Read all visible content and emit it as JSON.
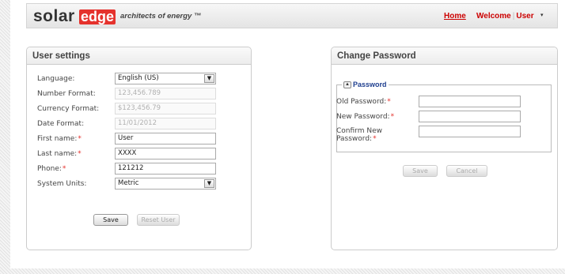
{
  "header": {
    "logo_solar": "solar",
    "logo_edge": "edge",
    "tagline": "architects of energy ™",
    "home_link": "Home",
    "welcome_label": "Welcome",
    "separator": "|",
    "user_name": "User",
    "menu_caret": "▾"
  },
  "user_settings": {
    "title": "User settings",
    "rows": {
      "language": {
        "label": "Language:",
        "value": "English (US)"
      },
      "number_format": {
        "label": "Number Format:",
        "placeholder": "123,456.789"
      },
      "currency_format": {
        "label": "Currency Format:",
        "placeholder": "$123,456.79"
      },
      "date_format": {
        "label": "Date Format:",
        "placeholder": "11/01/2012"
      },
      "first_name": {
        "label": "First name:",
        "value": "User"
      },
      "last_name": {
        "label": "Last name:",
        "value": "XXXX"
      },
      "phone": {
        "label": "Phone:",
        "value": "121212"
      },
      "system_units": {
        "label": "System Units:",
        "value": "Metric"
      }
    },
    "required_marker": "*",
    "save_label": "Save",
    "reset_label": "Reset User"
  },
  "change_password": {
    "title": "Change Password",
    "group_label": "Password",
    "collapse_glyph": "▲",
    "old_password_label": "Old Password:",
    "new_password_label": "New Password:",
    "confirm_password_label": "Confirm New Password:",
    "required_marker": "*",
    "save_label": "Save",
    "cancel_label": "Cancel"
  },
  "colors": {
    "brand_red": "#e5322d",
    "link_red": "#cc0000",
    "legend_blue": "#1f3f8f"
  },
  "icons": {
    "select_arrow": "chevron-down-icon",
    "collapse": "collapse-up-icon",
    "user_menu": "caret-down-icon"
  }
}
